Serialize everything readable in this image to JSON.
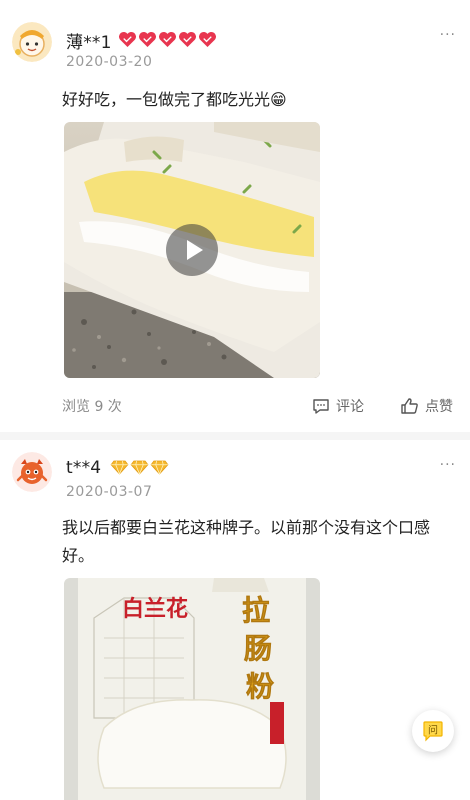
{
  "reviews": [
    {
      "username": "薄**1",
      "badge_icons": [
        "heart-badge-icon",
        "heart-badge-icon",
        "heart-badge-icon",
        "heart-badge-icon",
        "heart-badge-icon"
      ],
      "date": "2020-03-20",
      "content": "好好吃，一包做完了都吃光光😁",
      "media": "video-thumbnail",
      "views_label": "浏览 9 次",
      "comment_label": "评论",
      "like_label": "点赞"
    },
    {
      "username": "t**4",
      "badge_icons": [
        "diamond-badge-icon",
        "diamond-badge-icon",
        "diamond-badge-icon"
      ],
      "date": "2020-03-07",
      "content": "我以后都要白兰花这种牌子。以前那个没有这个口感好。",
      "media": "photo"
    }
  ],
  "product_packaging": {
    "brand": "白兰花",
    "product_name": "拉肠粉"
  },
  "more_label": "···",
  "floating_button_label": "问",
  "colors": {
    "badge_heart": "#e8354f",
    "badge_diamond": "#f5b82e",
    "muted_text": "#9a9a9a",
    "float_accent": "#f2b400"
  }
}
